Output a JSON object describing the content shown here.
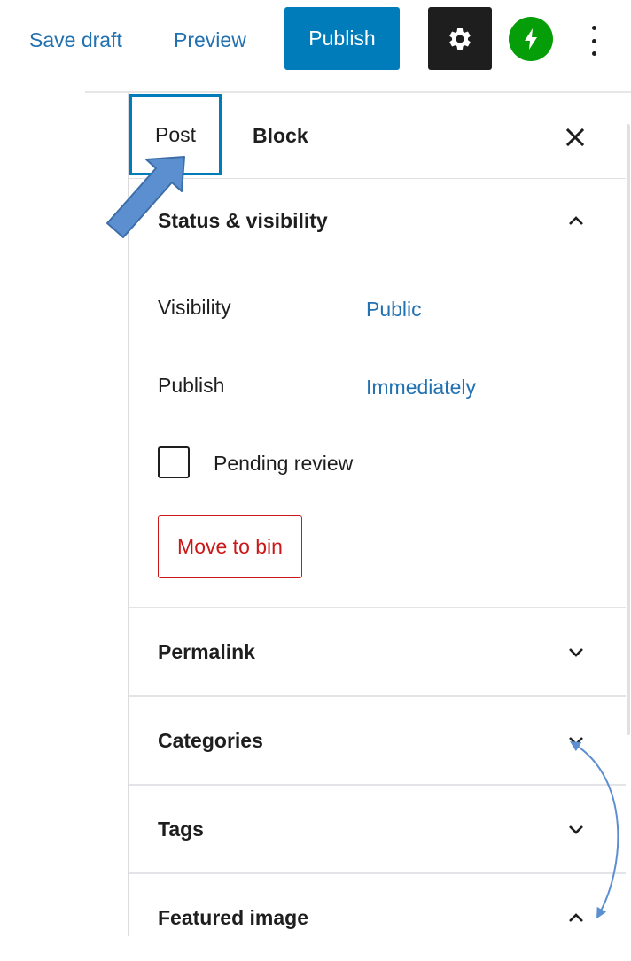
{
  "toolbar": {
    "save_draft": "Save draft",
    "preview": "Preview",
    "publish": "Publish",
    "settings_icon": "gear-icon",
    "jetpack_icon": "jetpack-bolt-icon",
    "more_icon": "more-vertical-icon"
  },
  "sidebar": {
    "tabs": [
      {
        "label": "Post",
        "active": true
      },
      {
        "label": "Block",
        "active": false
      }
    ],
    "close_icon": "close-icon",
    "status_panel": {
      "title": "Status & visibility",
      "expanded": true,
      "visibility_label": "Visibility",
      "visibility_value": "Public",
      "publish_label": "Publish",
      "publish_value": "Immediately",
      "pending_review_label": "Pending review",
      "pending_review_checked": false,
      "move_to_bin": "Move to bin"
    },
    "panels": [
      {
        "title": "Permalink",
        "expanded": false
      },
      {
        "title": "Categories",
        "expanded": false
      },
      {
        "title": "Tags",
        "expanded": false
      },
      {
        "title": "Featured image",
        "expanded": true
      }
    ]
  },
  "colors": {
    "accent": "#007cba",
    "link": "#2271b1",
    "danger": "#cc1818",
    "jetpack": "#069e08",
    "annotation_arrow": "#5b8fd0"
  }
}
